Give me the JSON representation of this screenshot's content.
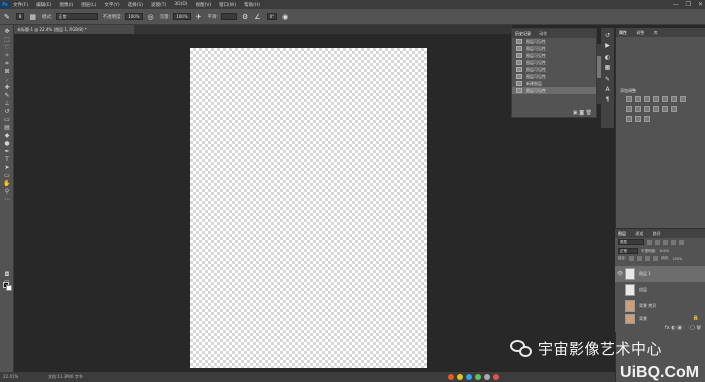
{
  "menubar": {
    "logo": "Ps",
    "items": [
      "文件(F)",
      "编辑(E)",
      "图像(I)",
      "图层(L)",
      "文字(Y)",
      "选择(S)",
      "滤镜(T)",
      "3D(D)",
      "视图(V)",
      "窗口(W)",
      "帮助(H)"
    ],
    "window_controls": [
      "—",
      "❐",
      "✕"
    ]
  },
  "options": {
    "mode_label": "模式:",
    "mode_value": "正常",
    "opacity_label": "不透明度:",
    "opacity_value": "100%",
    "flow_label": "流量:",
    "flow_value": "100%",
    "smooth_label": "平滑:",
    "angle_value": "0°",
    "brush_size": "8"
  },
  "document_tab": {
    "label": "未标题-1 @ 22.4% (图层 1, RGB/8) *"
  },
  "status": {
    "zoom": "22.41%",
    "doc": "文档:11.3M/0 字节"
  },
  "history": {
    "tabs": [
      "历史记录",
      "动作"
    ],
    "items": [
      {
        "label": "图层可见性"
      },
      {
        "label": "图层可见性"
      },
      {
        "label": "图层可见性"
      },
      {
        "label": "图层可见性"
      },
      {
        "label": "图层可见性"
      },
      {
        "label": "图层可见性"
      },
      {
        "label": "新建图层"
      },
      {
        "label": "图层可见性"
      }
    ],
    "selected_index": 7,
    "footer_icons": "▣ ◙ 🗑"
  },
  "right_panel": {
    "tabs": [
      "属性",
      "调整",
      "库"
    ],
    "adjust_title": "添加调整"
  },
  "layers": {
    "tabs": [
      "图层",
      "通道",
      "路径"
    ],
    "filter_label": "类型",
    "mode_value": "正常",
    "opacity_label": "不透明度:",
    "opacity_value": "100%",
    "lock_label": "锁定:",
    "fill_label": "填充:",
    "fill_value": "100%",
    "rows": [
      {
        "name": "图层 1"
      },
      {
        "name": "组层"
      },
      {
        "name": "背景 拷贝"
      },
      {
        "name": "背景"
      }
    ],
    "footer_icons": "fx ◐ ▣ 🗀 ▢ 🗑"
  },
  "watermark": {
    "text": "宇宙影像艺术中心"
  },
  "brand": {
    "prefix": "U",
    "text": "iBQ.CoM"
  }
}
